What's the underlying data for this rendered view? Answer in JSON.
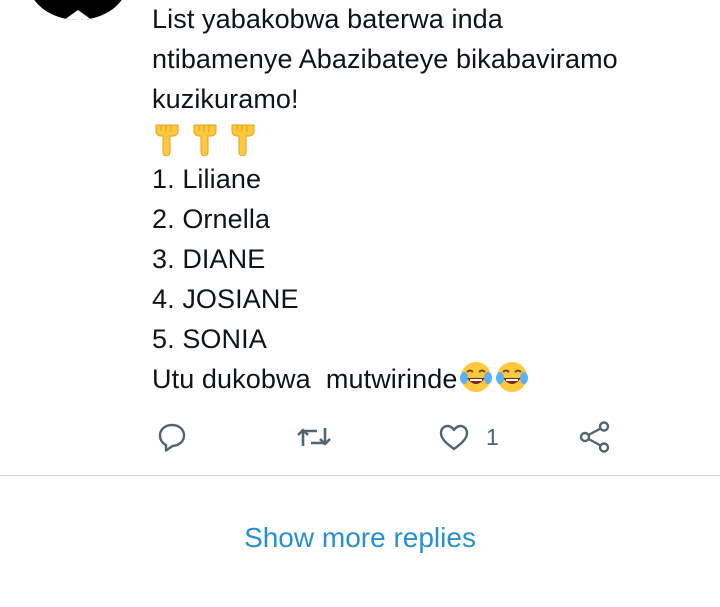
{
  "tweet": {
    "lines": [
      "List yabakobwa baterwa inda",
      "ntibamenye Abazibateye bikabaviramo",
      "kuzikuramo!"
    ],
    "emoji_row": [
      "backhand-index-pointing-down",
      "backhand-index-pointing-down",
      "backhand-index-pointing-down"
    ],
    "list": [
      "1. Liliane",
      "2. Ornella",
      "3. DIANE",
      "4. JOSIANE",
      "5. SONIA"
    ],
    "closing_text": "Utu dukobwa  mutwirinde",
    "closing_emojis": [
      "face-with-tears-of-joy",
      "face-with-tears-of-joy"
    ]
  },
  "actions": {
    "reply_icon": "reply-icon",
    "retweet_icon": "retweet-icon",
    "like_icon": "like-icon",
    "like_count": "1",
    "share_icon": "share-icon"
  },
  "colors": {
    "text": "#0f1419",
    "muted": "#536471",
    "link": "#2a8fd1",
    "divider": "#cfd9de",
    "emoji_yellow": "#ffc83d"
  },
  "show_more": {
    "label": "Show more replies"
  }
}
